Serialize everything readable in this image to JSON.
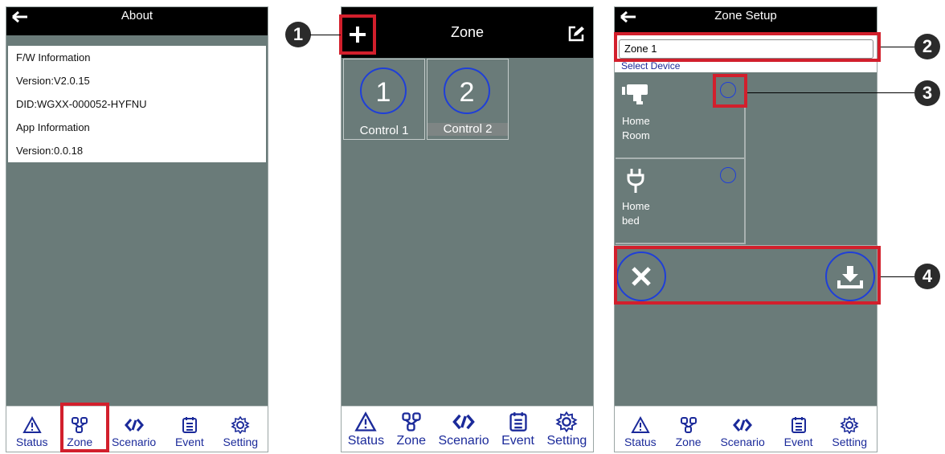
{
  "about_screen": {
    "title": "About",
    "fw_header": "F/W Information",
    "fw_version": "Version:V2.0.15",
    "fw_did": "DID:WGXX-000052-HYFNU",
    "app_header": "App Information",
    "app_version": "Version:0.0.18"
  },
  "zone_screen": {
    "title": "Zone",
    "zones": [
      {
        "number": "1",
        "label": "Control 1"
      },
      {
        "number": "2",
        "label": "Control 2"
      }
    ]
  },
  "zone_setup_screen": {
    "title": "Zone Setup",
    "zone_name_value": "Zone 1",
    "select_device_label": "Select Device",
    "devices": [
      {
        "line1": "Home",
        "line2": "Room",
        "icon": "camera-icon"
      },
      {
        "line1": "Home",
        "line2": "bed",
        "icon": "plug-icon"
      }
    ]
  },
  "tabs": [
    "Status",
    "Zone",
    "Scenario",
    "Event",
    "Setting"
  ],
  "callouts": [
    "1",
    "2",
    "3",
    "4"
  ],
  "colors": {
    "background": "#6a7b79",
    "topbar": "#000000",
    "tab_text": "#1b2a9a",
    "highlight": "#d21f2c",
    "accent_circle": "#1f3fd8"
  }
}
